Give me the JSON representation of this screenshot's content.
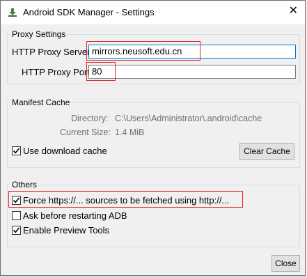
{
  "window": {
    "title": "Android SDK Manager - Settings",
    "close_glyph": "✕",
    "icon": "download-arrow-icon"
  },
  "proxy_settings": {
    "group_label": "Proxy Settings",
    "server_label": "HTTP Proxy Server",
    "server_value": "mirrors.neusoft.edu.cn",
    "port_label": "HTTP Proxy Port",
    "port_value": "80"
  },
  "manifest_cache": {
    "group_label": "Manifest Cache",
    "directory_label": "Directory:",
    "directory_value": "C:\\Users\\Administrator\\.android\\cache",
    "size_label": "Current Size:",
    "size_value": "1.4 MiB",
    "use_cache_label": "Use download cache",
    "use_cache_checked": true,
    "clear_cache_button": "Clear Cache"
  },
  "others": {
    "group_label": "Others",
    "options": [
      {
        "label": "Force https://... sources to be fetched using http://...",
        "checked": true
      },
      {
        "label": "Ask before restarting ADB",
        "checked": false
      },
      {
        "label": "Enable Preview Tools",
        "checked": true
      }
    ]
  },
  "footer": {
    "close_button": "Close"
  },
  "colors": {
    "highlight": "#e0252b",
    "focus_border": "#0078d7"
  }
}
